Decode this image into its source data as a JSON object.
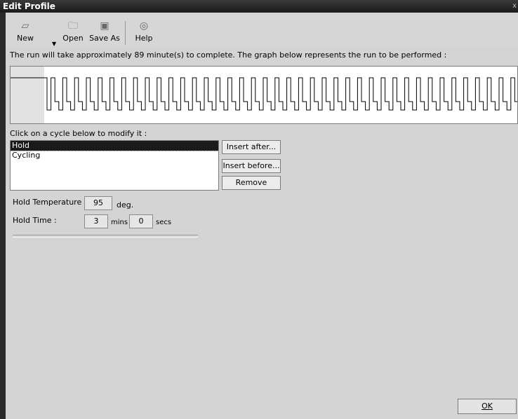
{
  "window": {
    "title": "Edit Profile",
    "close_glyph": "x"
  },
  "toolbar": {
    "new_label": "New",
    "open_label": "Open",
    "save_as_label": "Save As",
    "help_label": "Help",
    "new_icon": "new-file-icon",
    "open_icon": "open-folder-icon",
    "save_icon": "floppy-disk-icon",
    "help_icon": "help-icon"
  },
  "info_text": "The run will take approximately 89 minute(s) to complete. The graph below represents the run to be performed :",
  "click_msg": "Click on a cycle below to modify it :",
  "cycles": [
    {
      "label": "Hold",
      "selected": true
    },
    {
      "label": "Cycling",
      "selected": false
    }
  ],
  "buttons": {
    "insert_after": "Insert after...",
    "insert_before": "Insert before...",
    "remove": "Remove",
    "ok": "OK"
  },
  "hold": {
    "temp_label": "Hold Temperature :",
    "temp_value": "95",
    "temp_unit": "deg.",
    "time_label": "Hold Time :",
    "mins_value": "3",
    "mins_unit": "mins",
    "secs_value": "0",
    "secs_unit": "secs"
  }
}
